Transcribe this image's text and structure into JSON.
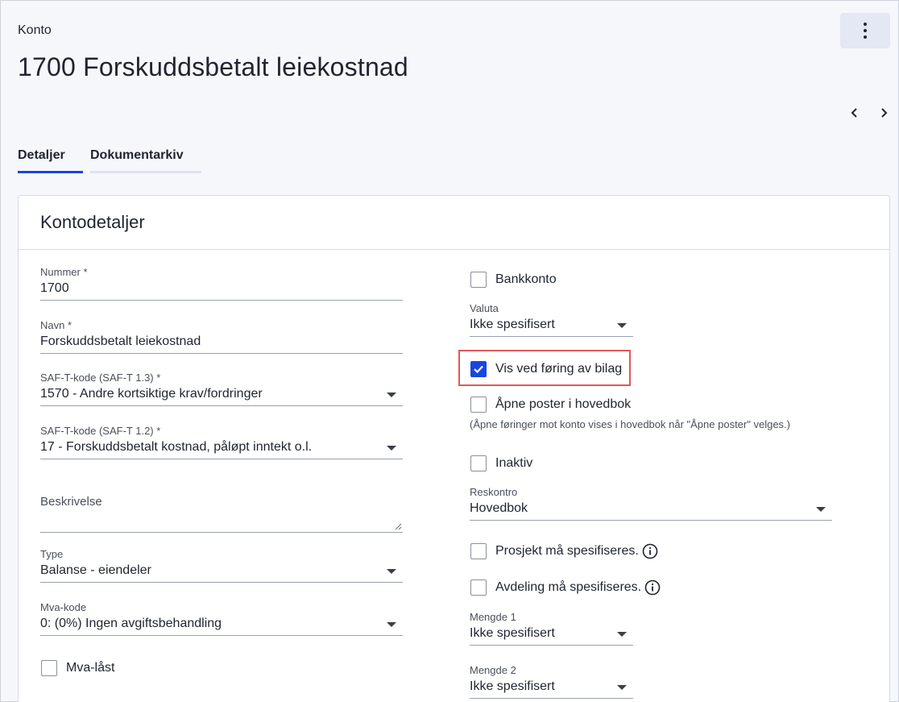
{
  "header": {
    "breadcrumb": "Konto",
    "title": "1700 Forskuddsbetalt leiekostnad"
  },
  "tabs": [
    {
      "label": "Detaljer",
      "active": true
    },
    {
      "label": "Dokumentarkiv",
      "active": false
    }
  ],
  "card": {
    "title": "Kontodetaljer",
    "left": {
      "nummer": {
        "label": "Nummer *",
        "value": "1700"
      },
      "navn": {
        "label": "Navn *",
        "value": "Forskuddsbetalt leiekostnad"
      },
      "saft13": {
        "label": "SAF-T-kode (SAF-T 1.3) *",
        "value": "1570 - Andre kortsiktige krav/fordringer"
      },
      "saft12": {
        "label": "SAF-T-kode (SAF-T 1.2) *",
        "value": "17 - Forskuddsbetalt kostnad, påløpt inntekt o.l."
      },
      "beskrivelse": {
        "label": "Beskrivelse",
        "value": ""
      },
      "type": {
        "label": "Type",
        "value": "Balanse - eiendeler"
      },
      "mvakode": {
        "label": "Mva-kode",
        "value": "0: (0%) Ingen avgiftsbehandling"
      },
      "mvalaast": {
        "label": "Mva-låst",
        "checked": false
      }
    },
    "right": {
      "bankkonto": {
        "label": "Bankkonto",
        "checked": false
      },
      "valuta": {
        "label": "Valuta",
        "value": "Ikke spesifisert"
      },
      "visVedForing": {
        "label": "Vis ved føring av bilag",
        "checked": true
      },
      "aapnePoster": {
        "label": "Åpne poster i hovedbok",
        "checked": false,
        "hint": "(Åpne føringer mot konto vises i hovedbok når \"Åpne poster\" velges.)"
      },
      "inaktiv": {
        "label": "Inaktiv",
        "checked": false
      },
      "reskontro": {
        "label": "Reskontro",
        "value": "Hovedbok"
      },
      "prosjekt": {
        "label": "Prosjekt må spesifiseres.",
        "checked": false
      },
      "avdeling": {
        "label": "Avdeling må spesifiseres.",
        "checked": false
      },
      "mengde1": {
        "label": "Mengde 1",
        "value": "Ikke spesifisert"
      },
      "mengde2": {
        "label": "Mengde 2",
        "value": "Ikke spesifisert"
      }
    }
  },
  "colors": {
    "accent": "#1a46e0",
    "highlight": "#e0585c"
  }
}
